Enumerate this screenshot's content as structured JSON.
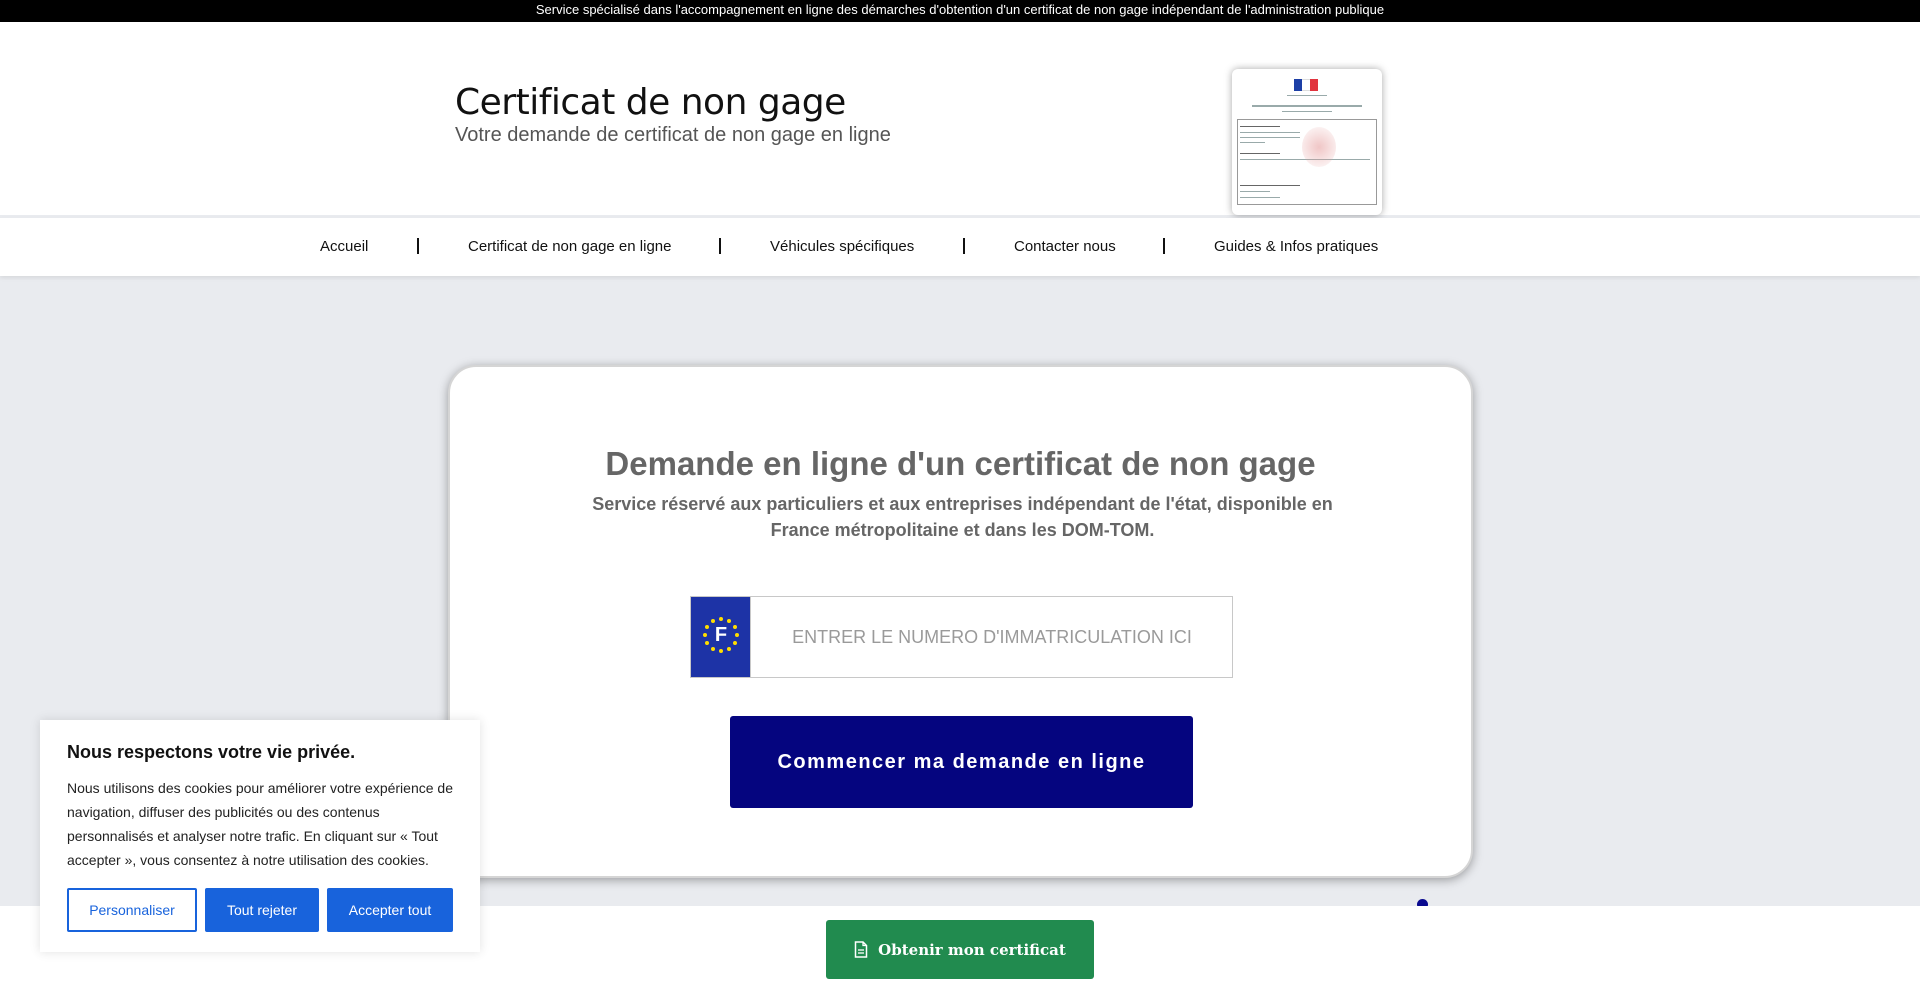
{
  "topbar": {
    "text": "Service spécialisé dans l'accompagnement en ligne des démarches d'obtention d'un certificat de non gage indépendant de l'administration publique"
  },
  "header": {
    "title": "Certificat de non gage",
    "subtitle": "Votre demande de certificat de non gage en ligne"
  },
  "nav": {
    "items": [
      {
        "label": "Accueil"
      },
      {
        "label": "Certificat de non gage en ligne"
      },
      {
        "label": "Véhicules spécifiques"
      },
      {
        "label": "Contacter nous"
      },
      {
        "label": "Guides & Infos pratiques"
      }
    ]
  },
  "main": {
    "title": "Demande en ligne d'un certificat de non gage",
    "subtitle": "Service réservé aux particuliers et aux entreprises indépendant de l'état, disponible en France métropolitaine et dans les DOM-TOM.",
    "plate": {
      "country_code": "F",
      "placeholder": "ENTRER LE NUMERO D'IMMATRICULATION ICI",
      "value": ""
    },
    "cta_label": "Commencer ma demande en ligne"
  },
  "bottom": {
    "obtain_label": "Obtenir mon certificat"
  },
  "cookie": {
    "title": "Nous respectons votre vie privée.",
    "text": "Nous utilisons des cookies pour améliorer votre expérience de navigation, diffuser des publicités ou des contenus personnalisés et analyser notre trafic. En cliquant sur « Tout accepter », vous consentez à notre utilisation des cookies.",
    "customize_label": "Personnaliser",
    "reject_label": "Tout rejeter",
    "accept_label": "Accepter tout"
  },
  "icons": {
    "document": "document-icon",
    "eu_stars": "eu-stars-icon"
  },
  "colors": {
    "cta": "#05057f",
    "obtain": "#218b4f",
    "cookie_accent": "#1863dc",
    "eu_blue": "#1d33a6",
    "eu_yellow": "#ffdd00"
  }
}
